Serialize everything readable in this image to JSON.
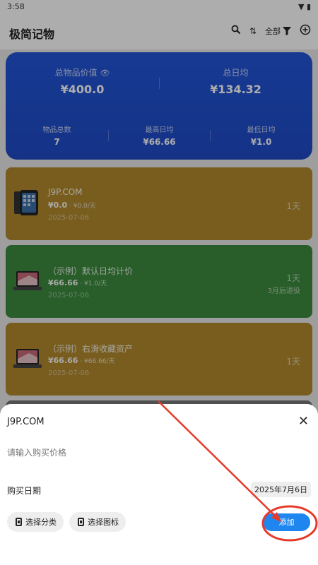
{
  "status_bar": {
    "time": "3:58"
  },
  "app_bar": {
    "title": "极简记物",
    "filter_label": "全部"
  },
  "summary": {
    "total_value_label": "总物品价值",
    "total_value": "¥400.0",
    "daily_avg_label": "总日均",
    "daily_avg": "¥134.32",
    "count_label": "物品总数",
    "count": "7",
    "max_daily_label": "最高日均",
    "max_daily": "¥66.66",
    "min_daily_label": "最低日均",
    "min_daily": "¥1.0"
  },
  "items": [
    {
      "name": "J9P.COM",
      "price": "¥0.0",
      "per_day": " · ¥0.0/天",
      "date": "2025-07-06",
      "days": "1天",
      "retire": "",
      "color": "#b28a2e",
      "icon": "phone-icon"
    },
    {
      "name": "（示例）默认日均计价",
      "price": "¥66.66",
      "per_day": " · ¥1.0/天",
      "date": "2025-07-06",
      "days": "1天",
      "retire": "3月后退役",
      "color": "#3d8b3e",
      "icon": "laptop-icon"
    },
    {
      "name": "（示例）右滑收藏资产",
      "price": "¥66.66",
      "per_day": " · ¥66.66/天",
      "date": "2025-07-06",
      "days": "1天",
      "retire": "",
      "color": "#b28a2e",
      "icon": "laptop-icon"
    }
  ],
  "sheet": {
    "title": "J9P.COM",
    "price_placeholder": "请输入购买价格",
    "date_label": "购买日期",
    "date_value": "2025年7月6日",
    "category_button": "选择分类",
    "icon_button": "选择图标",
    "add_button": "添加"
  },
  "colors": {
    "accent": "#1f86f0",
    "summary_card": "#2255d8",
    "annotation": "#e53a2a"
  }
}
